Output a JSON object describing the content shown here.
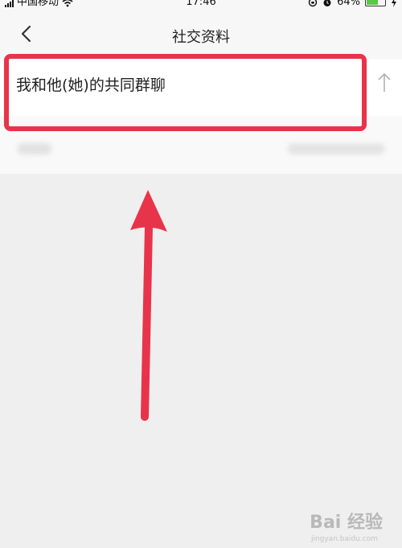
{
  "status_bar": {
    "carrier": "中国移动",
    "time": "17:46",
    "battery": "64%",
    "battery_level": 0.64
  },
  "nav": {
    "title": "社交资料",
    "back_icon": "chevron-left-icon"
  },
  "rows": [
    {
      "label": "我和他(她)的共同群聊",
      "arrow_icon": "chevron-up-icon"
    }
  ],
  "annotation": {
    "highlight_color": "#e8344a",
    "arrow_color": "#e8344a"
  },
  "watermark": {
    "text": "Bai 经验",
    "sub": "jingyan.baidu.com"
  }
}
